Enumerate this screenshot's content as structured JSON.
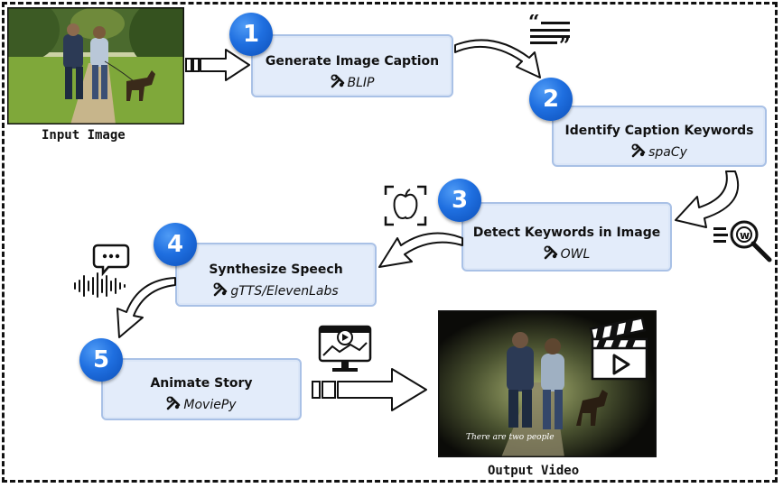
{
  "input_caption": "Input Image",
  "output_caption": "Output Video",
  "video_subtitle": "There are two people",
  "steps": [
    {
      "number": "1",
      "title": "Generate Image Caption",
      "tool": "BLIP"
    },
    {
      "number": "2",
      "title": "Identify Caption Keywords",
      "tool": "spaCy"
    },
    {
      "number": "3",
      "title": "Detect Keywords in Image",
      "tool": "OWL"
    },
    {
      "number": "4",
      "title": "Synthesize Speech",
      "tool": "gTTS/ElevenLabs"
    },
    {
      "number": "5",
      "title": "Animate Story",
      "tool": "MoviePy"
    }
  ],
  "icons": {
    "step1": "quote-text-icon",
    "step2": "keyword-search-icon",
    "step3": "object-detection-icon",
    "step4": "speech-icon",
    "step5": "video-monitor-icon",
    "output": "clapperboard-icon",
    "tool": "tools-icon"
  },
  "colors": {
    "box_fill": "#e3ecfa",
    "box_border": "#a9c1e6",
    "badge": "#1f6fe0"
  }
}
